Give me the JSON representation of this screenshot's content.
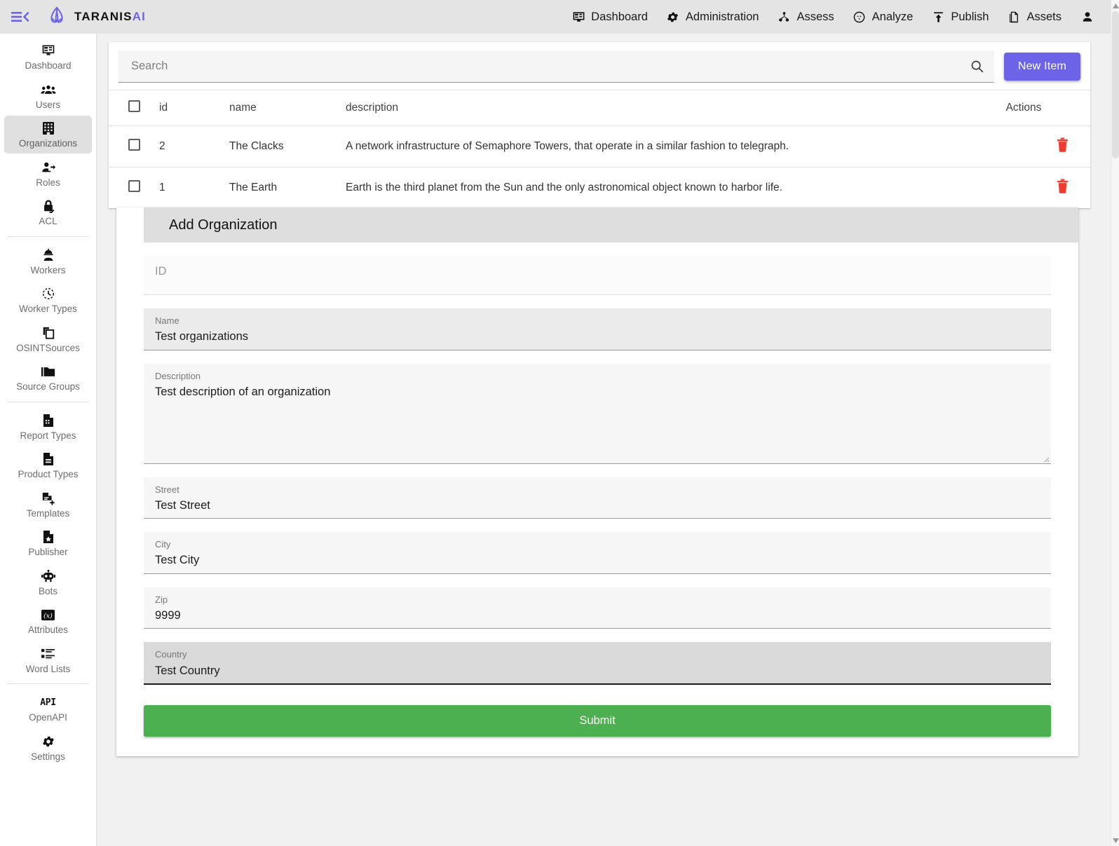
{
  "topbar": {
    "menu_toggle_icon": "menu-collapse-icon",
    "brand_name": "TARANIS",
    "brand_suffix": "AI",
    "nav": [
      {
        "label": "Dashboard",
        "icon": "dashboard-icon"
      },
      {
        "label": "Administration",
        "icon": "gear-icon"
      },
      {
        "label": "Assess",
        "icon": "assess-nodes-icon"
      },
      {
        "label": "Analyze",
        "icon": "analyze-target-icon"
      },
      {
        "label": "Publish",
        "icon": "upload-icon"
      },
      {
        "label": "Assets",
        "icon": "documents-icon"
      }
    ],
    "account_icon": "user-account-icon"
  },
  "sidebar": {
    "groups": [
      {
        "items": [
          {
            "label": "Dashboard",
            "icon": "dashboard-icon",
            "active": false
          },
          {
            "label": "Users",
            "icon": "users-icon",
            "active": false
          },
          {
            "label": "Organizations",
            "icon": "organizations-building-icon",
            "active": true
          },
          {
            "label": "Roles",
            "icon": "role-person-arrow-icon",
            "active": false
          },
          {
            "label": "ACL",
            "icon": "lock-check-icon",
            "active": false
          }
        ]
      },
      {
        "items": [
          {
            "label": "Workers",
            "icon": "worker-helmet-icon",
            "active": false
          },
          {
            "label": "Worker Types",
            "icon": "worker-types-clock-icon",
            "active": false
          },
          {
            "label": "OSINTSources",
            "icon": "copy-stack-icon",
            "active": false
          },
          {
            "label": "Source Groups",
            "icon": "folder-icon",
            "active": false
          }
        ]
      },
      {
        "items": [
          {
            "label": "Report Types",
            "icon": "report-doc-icon",
            "active": false
          },
          {
            "label": "Product Types",
            "icon": "product-doc-icon",
            "active": false
          },
          {
            "label": "Templates",
            "icon": "doc-plus-icon",
            "active": false
          },
          {
            "label": "Publisher",
            "icon": "doc-star-icon",
            "active": false
          },
          {
            "label": "Bots",
            "icon": "robot-icon",
            "active": false
          },
          {
            "label": "Attributes",
            "icon": "variable-x-icon",
            "active": false
          },
          {
            "label": "Word Lists",
            "icon": "list-icon",
            "active": false
          }
        ]
      },
      {
        "items": [
          {
            "label": "OpenAPI",
            "icon": "api-text-icon",
            "active": false
          },
          {
            "label": "Settings",
            "icon": "gear-icon",
            "active": false
          }
        ]
      }
    ]
  },
  "table_panel": {
    "search": {
      "value": "",
      "placeholder": "Search",
      "icon": "search-icon"
    },
    "new_item_label": "New Item",
    "new_item_color": "#6c63e8",
    "columns": [
      "",
      "id",
      "name",
      "description",
      "Actions"
    ],
    "rows": [
      {
        "selected": false,
        "id": "2",
        "name": "The Clacks",
        "description": "A network infrastructure of Semaphore Towers, that operate in a similar fashion to telegraph.",
        "action_icon": "trash-delete-icon"
      },
      {
        "selected": false,
        "id": "1",
        "name": "The Earth",
        "description": "Earth is the third planet from the Sun and the only astronomical object known to harbor life.",
        "action_icon": "trash-delete-icon"
      }
    ],
    "select_all_checked": false,
    "delete_icon_color": "#f13a2e"
  },
  "form": {
    "title": "Add Organization",
    "fields": [
      {
        "key": "id",
        "label": "",
        "placeholder": "ID",
        "value": "",
        "state": "disabled",
        "type": "text"
      },
      {
        "key": "name",
        "label": "Name",
        "placeholder": "",
        "value": "Test organizations",
        "state": "filled",
        "type": "text"
      },
      {
        "key": "description",
        "label": "Description",
        "placeholder": "",
        "value": "Test description of an organization",
        "state": "normal",
        "type": "textarea"
      },
      {
        "key": "street",
        "label": "Street",
        "placeholder": "",
        "value": "Test Street",
        "state": "normal",
        "type": "text"
      },
      {
        "key": "city",
        "label": "City",
        "placeholder": "",
        "value": "Test City",
        "state": "normal",
        "type": "text"
      },
      {
        "key": "zip",
        "label": "Zip",
        "placeholder": "",
        "value": "9999",
        "state": "normal",
        "type": "text"
      },
      {
        "key": "country",
        "label": "Country",
        "placeholder": "",
        "value": "Test Country",
        "state": "focused",
        "type": "text"
      }
    ],
    "submit_label": "Submit",
    "submit_color": "#4caf50"
  }
}
